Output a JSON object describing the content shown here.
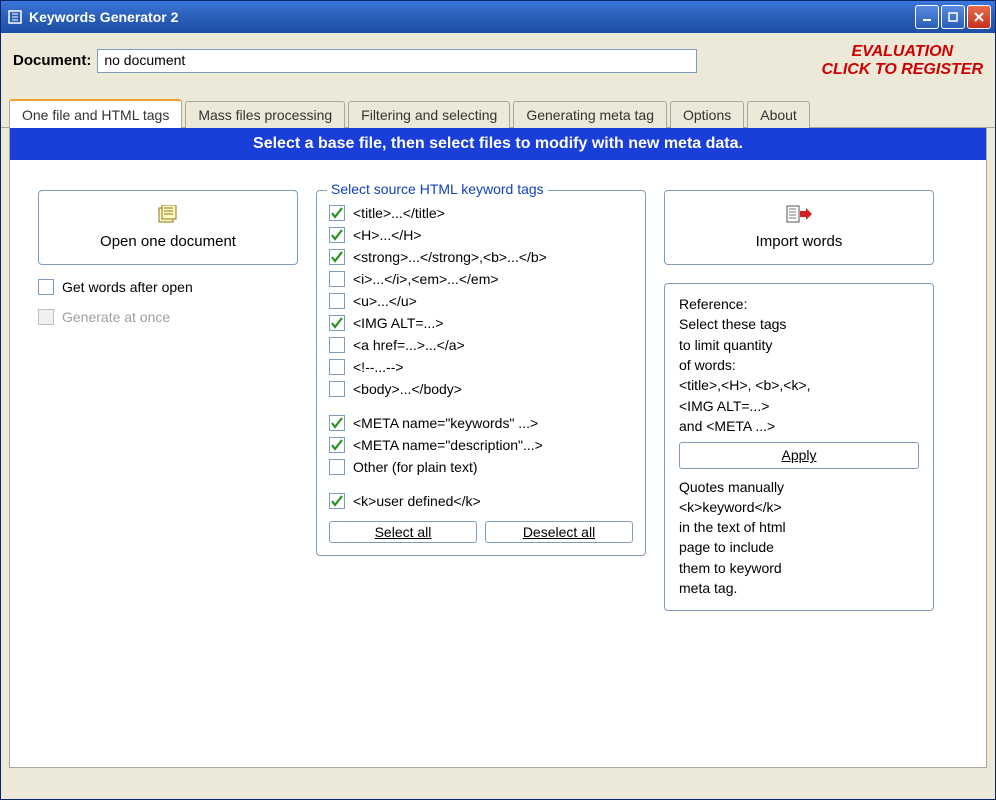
{
  "window": {
    "title": "Keywords Generator 2"
  },
  "top": {
    "doc_label": "Document:",
    "doc_value": "no document",
    "eval_line1": "EVALUATION",
    "eval_line2": "CLICK TO REGISTER"
  },
  "tabs": [
    {
      "label": "One file and HTML tags",
      "active": true
    },
    {
      "label": "Mass files processing",
      "active": false
    },
    {
      "label": "Filtering and selecting",
      "active": false
    },
    {
      "label": "Generating meta tag",
      "active": false
    },
    {
      "label": "Options",
      "active": false
    },
    {
      "label": "About",
      "active": false
    }
  ],
  "banner": "Select a base file, then select files to modify with new meta data.",
  "left": {
    "open_btn": "Open one document",
    "get_words": {
      "label": "Get words after open",
      "checked": false,
      "disabled": false
    },
    "gen_once": {
      "label": "Generate at once",
      "checked": false,
      "disabled": true
    }
  },
  "tags_group": {
    "title": "Select source HTML keyword tags",
    "items": [
      {
        "label": "<title>...</title>",
        "checked": true
      },
      {
        "label": "<H>...</H>",
        "checked": true
      },
      {
        "label": "<strong>...</strong>,<b>...</b>",
        "checked": true
      },
      {
        "label": "<i>...</i>,<em>...</em>",
        "checked": false
      },
      {
        "label": "<u>...</u>",
        "checked": false
      },
      {
        "label": "<IMG ALT=...>",
        "checked": true
      },
      {
        "label": "<a href=...>...</a>",
        "checked": false
      },
      {
        "label": "<!--...-->",
        "checked": false
      },
      {
        "label": "<body>...</body>",
        "checked": false
      }
    ],
    "items2": [
      {
        "label": "<META name=\"keywords\" ...>",
        "checked": true
      },
      {
        "label": "<META name=\"description\"...>",
        "checked": true
      },
      {
        "label": "Other (for plain text)",
        "checked": false
      }
    ],
    "items3": [
      {
        "label": "<k>user defined</k>",
        "checked": true
      }
    ],
    "select_all": "Select all",
    "deselect_all": "Deselect all"
  },
  "right": {
    "import_btn": "Import words",
    "ref_lines_top": [
      "Reference:",
      "Select these tags",
      "to limit quantity",
      "of words:",
      "<title>,<H>, <b>,<k>,",
      "<IMG ALT=...>",
      "and <META ...>"
    ],
    "apply": "Apply",
    "ref_lines_bottom": [
      "Quotes manually",
      "<k>keyword</k>",
      "in the text of html",
      "page to include",
      "them to keyword",
      "meta tag."
    ]
  }
}
